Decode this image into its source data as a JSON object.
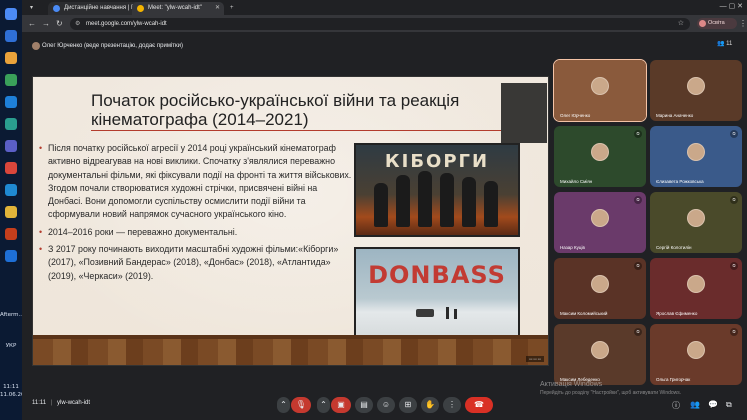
{
  "taskbar": {
    "weather_label": "Afterm...",
    "lang": "УКР",
    "clock_time": "11:11",
    "clock_date": "11.06.2024"
  },
  "browser": {
    "tabs": [
      {
        "label": "Дистанційне навчання | Вікі..."
      },
      {
        "label": "Meet: \"ylw-wcah-idt\""
      }
    ],
    "url": "meet.google.com/ylw-wcah-idt",
    "profile_label": "Освіта"
  },
  "meet": {
    "presenter_text": "Олег Юрченко (веде презентацію, додає примітки)",
    "meeting_time": "11:11",
    "meeting_code": "ylw-wcah-idt",
    "participant_count": "11"
  },
  "slide": {
    "title": "Початок російсько-української війни та реакція кінематографа (2014–2021)",
    "bullets": [
      "Після початку російської агресії у 2014 році український кінематограф активно відреагував на нові виклики. Спочатку з'являлися переважно документальні фільми, які фіксували події на фронті та життя військових. Згодом почали створюватися художні стрічки, присвячені війні на Донбасі. Вони допомогли суспільству осмислити події війни та сформували новий напрямок сучасного українського кіно.",
      "2014–2016 роки — переважно документальні.",
      "З 2017 року починають виходити масштабні художні фільми:«Кіборги» (2017), «Позивний Бандерас» (2018), «Донбас» (2018), «Атлантида» (2019), «Черкаси» (2019)."
    ],
    "poster1_title": "КІБОРГИ",
    "poster2_title": "DONBASS"
  },
  "participants": [
    {
      "name": "Олег Юрченко",
      "color": "#8a5a3c"
    },
    {
      "name": "Марина Аначенко",
      "color": "#5a3a28"
    },
    {
      "name": "Михайло Сміян",
      "color": "#2d4a2c"
    },
    {
      "name": "Єлизавета Рожковська",
      "color": "#3a5a8a"
    },
    {
      "name": "Назар Куців",
      "color": "#6a3a6a"
    },
    {
      "name": "Сергій Колотилін",
      "color": "#4a4a2a"
    },
    {
      "name": "Максим Коломийський",
      "color": "#5a3326"
    },
    {
      "name": "Ярослав Єфименко",
      "color": "#6a2c2c"
    },
    {
      "name": "Максим Лебеденко",
      "color": "#5a3a2a"
    },
    {
      "name": "Ольга Григорчак",
      "color": "#6a3a2a"
    }
  ],
  "watermark": {
    "line1": "Активація Windows",
    "line2": "Перейдіть до розділу \"Настройки\", щоб активувати Windows."
  }
}
